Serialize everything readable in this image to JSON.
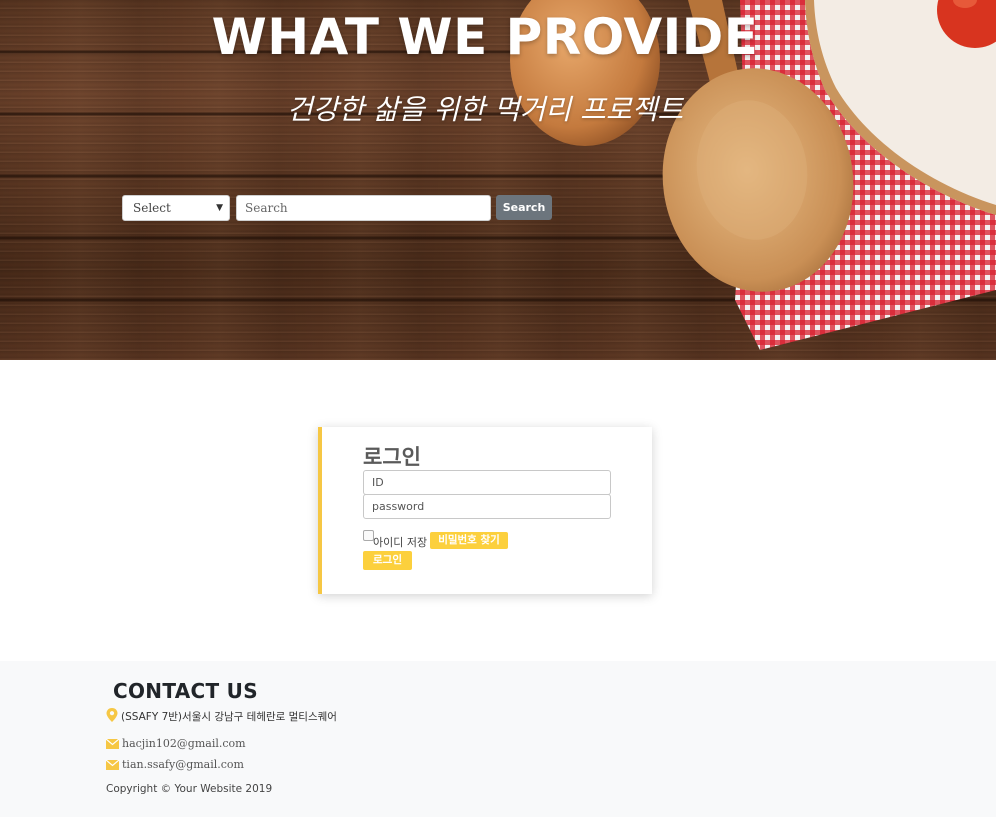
{
  "hero": {
    "title": "WHAT WE PROVIDE",
    "subtitle": "건강한 삶을 위한 먹거리 프로젝트",
    "select_label": "Select",
    "search_placeholder": "Search",
    "search_button": "Search"
  },
  "login": {
    "title": "로그인",
    "id_placeholder": "ID",
    "password_placeholder": "password",
    "remember_label": "아이디 저장",
    "find_password_button": "비밀번호 찾기",
    "login_button": "로그인"
  },
  "footer": {
    "title": "CONTACT US",
    "address": "(SSAFY 7반)서울시 강남구 테헤란로 멀티스퀘어",
    "emails": [
      "hacjin102@gmail.com",
      "tian.ssafy@gmail.com"
    ],
    "copyright": "Copyright © Your Website 2019"
  },
  "colors": {
    "accent_yellow": "#fcd03d",
    "card_border": "#f6c744",
    "search_button": "#6c757d",
    "footer_bg": "#f8f9fa"
  },
  "icons": {
    "address": "map-pin-icon",
    "email": "mail-icon"
  }
}
